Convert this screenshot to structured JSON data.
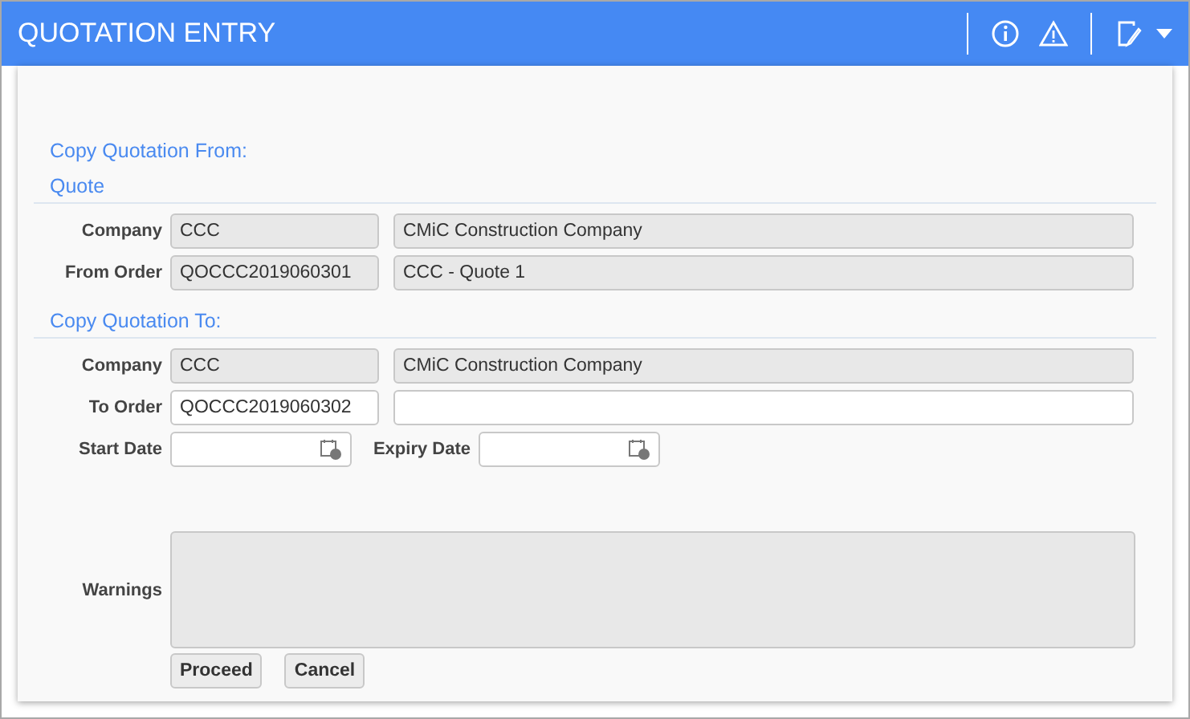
{
  "window": {
    "title": "QUOTATION ENTRY"
  },
  "intro": "Copy Quotation From:",
  "sections": [
    {
      "heading": "Quote",
      "rows": [
        {
          "kind": "pair",
          "label": "Company",
          "code": {
            "value": "CCC",
            "disabled": true
          },
          "name": {
            "value": "CMiC Construction Company",
            "disabled": true
          }
        },
        {
          "kind": "pair",
          "label": "From Order",
          "code": {
            "value": "QOCCC2019060301",
            "disabled": true
          },
          "name": {
            "value": "CCC - Quote 1",
            "disabled": true
          }
        }
      ]
    },
    {
      "heading": "Copy Quotation To:",
      "rows": [
        {
          "kind": "pair",
          "label": "Company",
          "code": {
            "value": "CCC",
            "disabled": true
          },
          "name": {
            "value": "CMiC Construction Company",
            "disabled": true
          }
        },
        {
          "kind": "pair",
          "label": "To Order",
          "code": {
            "value": "QOCCC2019060302",
            "disabled": false
          },
          "name": {
            "disabled": false
          }
        },
        {
          "kind": "dates",
          "label": "Start Date",
          "second_label": "Expiry Date"
        }
      ]
    }
  ],
  "warnings": {
    "label": "Warnings",
    "disabled": true
  },
  "buttons": [
    "Proceed",
    "Cancel"
  ]
}
